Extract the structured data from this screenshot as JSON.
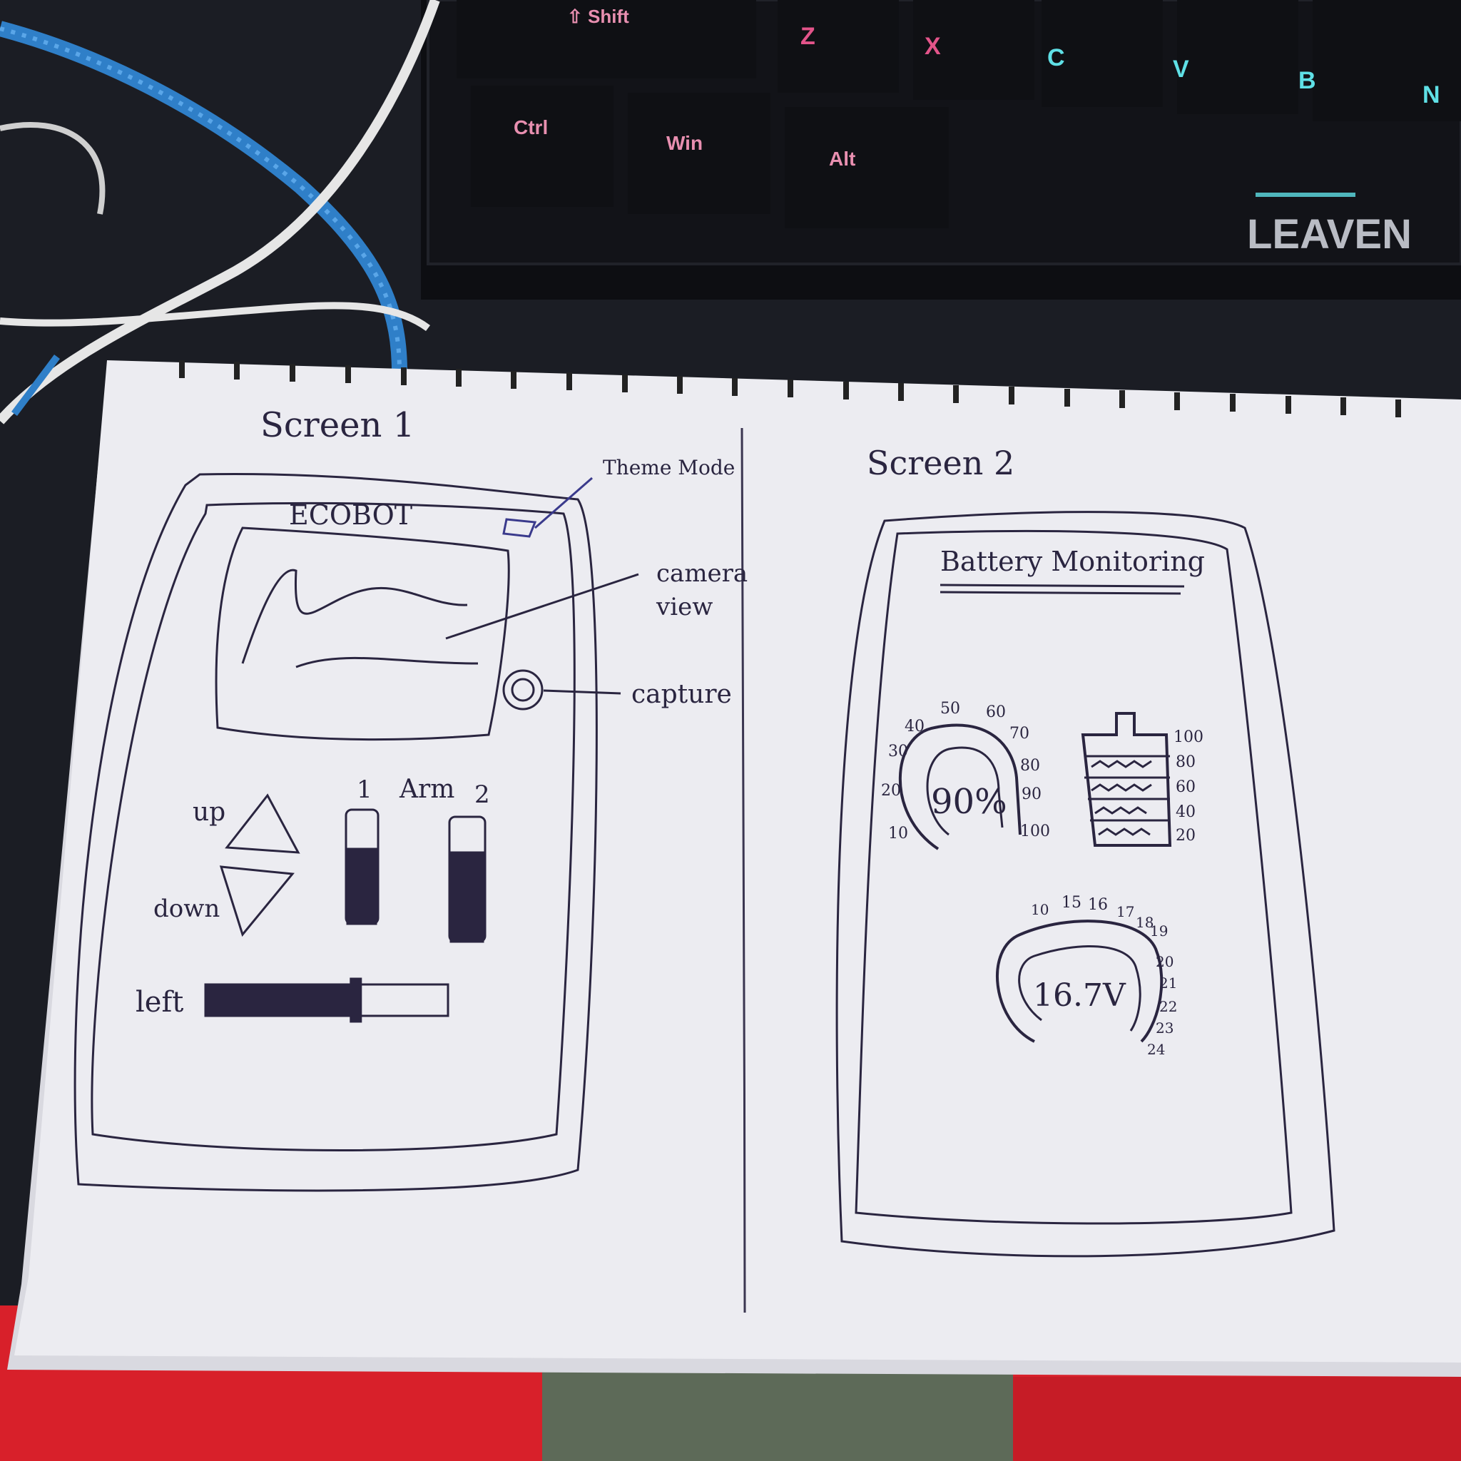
{
  "keyboard": {
    "brand": "LEAVEN",
    "keys": [
      {
        "label": "⇧ Shift",
        "color": "#e88fb0"
      },
      {
        "label": "Z",
        "color": "#e3548a"
      },
      {
        "label": "X",
        "color": "#e3548a"
      },
      {
        "label": "C",
        "color": "#5fe0e6"
      },
      {
        "label": "V",
        "color": "#5fe0e6"
      },
      {
        "label": "B",
        "color": "#5fe0e6"
      },
      {
        "label": "N",
        "color": "#5fe0e6"
      },
      {
        "label": "Ctrl",
        "color": "#e88fb0"
      },
      {
        "label": "Win",
        "color": "#e88fb0"
      },
      {
        "label": "Alt",
        "color": "#e88fb0"
      }
    ]
  },
  "screen1": {
    "title": "Screen 1",
    "app_name": "ECOBOT",
    "annotations": {
      "theme_mode": "Theme Mode",
      "camera_view_1": "camera",
      "camera_view_2": "view",
      "capture": "capture"
    },
    "controls": {
      "up": "up",
      "down": "down",
      "arm": "Arm",
      "arm_1": "1",
      "arm_2": "2",
      "left": "left",
      "left_slider_fraction": 0.62
    }
  },
  "screen2": {
    "title": "Screen 2",
    "heading": "Battery Monitoring",
    "gauge1": {
      "value_text": "90%",
      "ticks": [
        "10",
        "20",
        "30",
        "40",
        "50",
        "60",
        "70",
        "80",
        "90",
        "100"
      ]
    },
    "battery": {
      "ticks": [
        "100",
        "80",
        "60",
        "40",
        "20"
      ]
    },
    "gauge2": {
      "value_text": "16.7V",
      "ticks": [
        "10",
        "15",
        "16",
        "17",
        "18",
        "19",
        "20",
        "21",
        "22",
        "23",
        "24"
      ]
    }
  },
  "colors": {
    "paper": "#e9e9ef",
    "ink": "#2a2540",
    "blue_ink": "#3a3a8c",
    "red_surface": "#d8202a"
  }
}
